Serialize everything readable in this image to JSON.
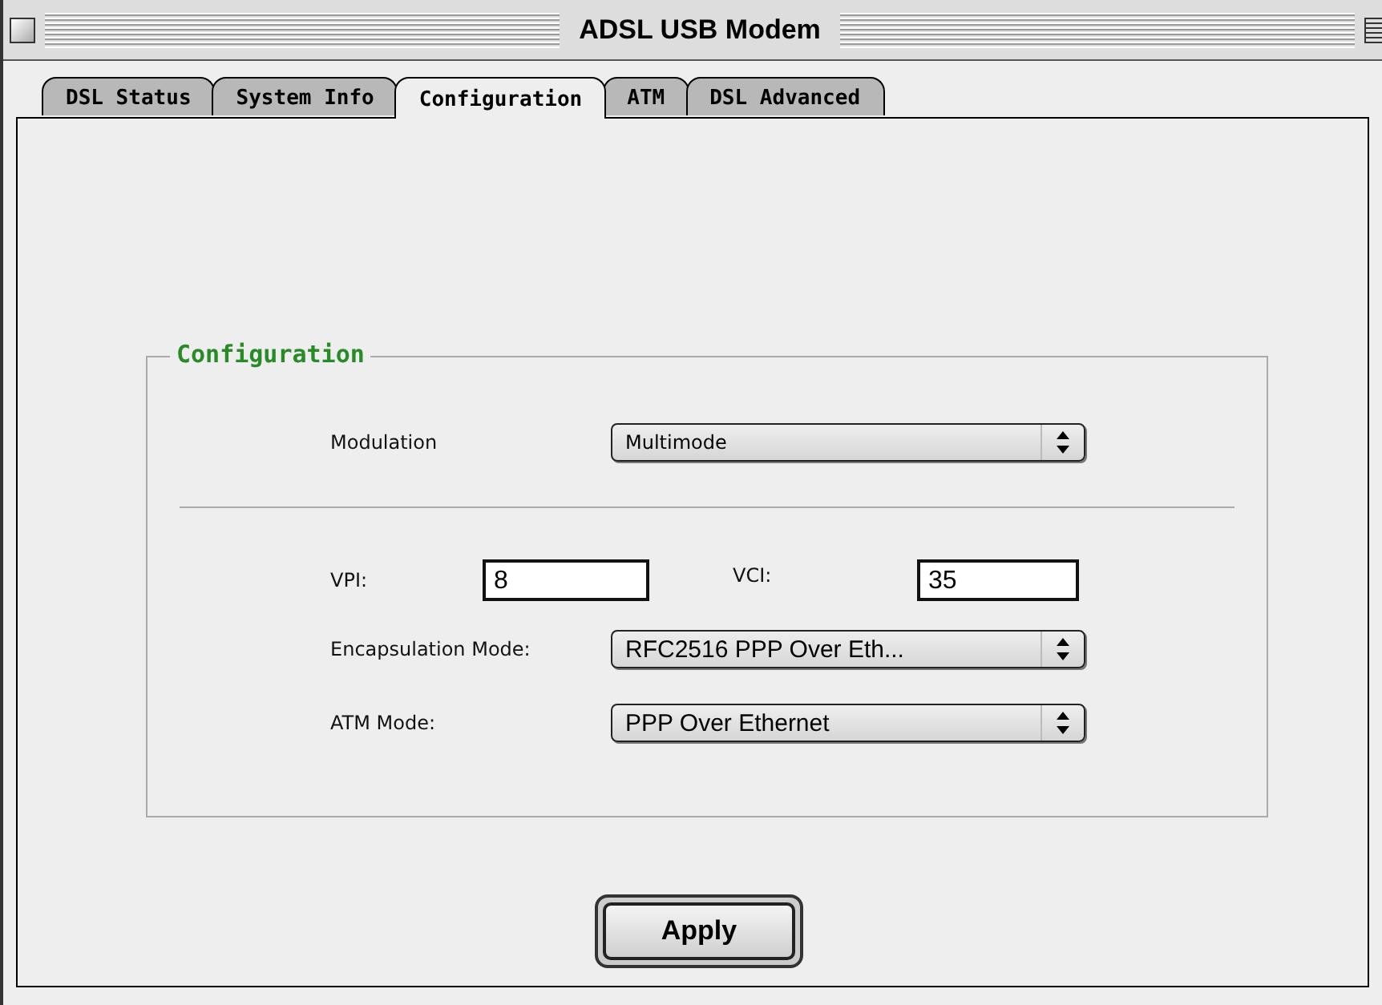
{
  "window": {
    "title": "ADSL USB Modem"
  },
  "tabs": [
    {
      "label": "DSL Status",
      "selected": false
    },
    {
      "label": "System Info",
      "selected": false
    },
    {
      "label": "Configuration",
      "selected": true
    },
    {
      "label": "ATM",
      "selected": false
    },
    {
      "label": "DSL Advanced",
      "selected": false
    }
  ],
  "group": {
    "title": "Configuration",
    "modulation": {
      "label": "Modulation",
      "value": "Multimode"
    },
    "vpi": {
      "label": "VPI:",
      "value": "8"
    },
    "vci": {
      "label": "VCI:",
      "value": "35"
    },
    "encapsulation": {
      "label": "Encapsulation Mode:",
      "value": "RFC2516 PPP Over Eth..."
    },
    "atm_mode": {
      "label": "ATM Mode:",
      "value": "PPP Over Ethernet"
    }
  },
  "buttons": [
    "Apply"
  ]
}
